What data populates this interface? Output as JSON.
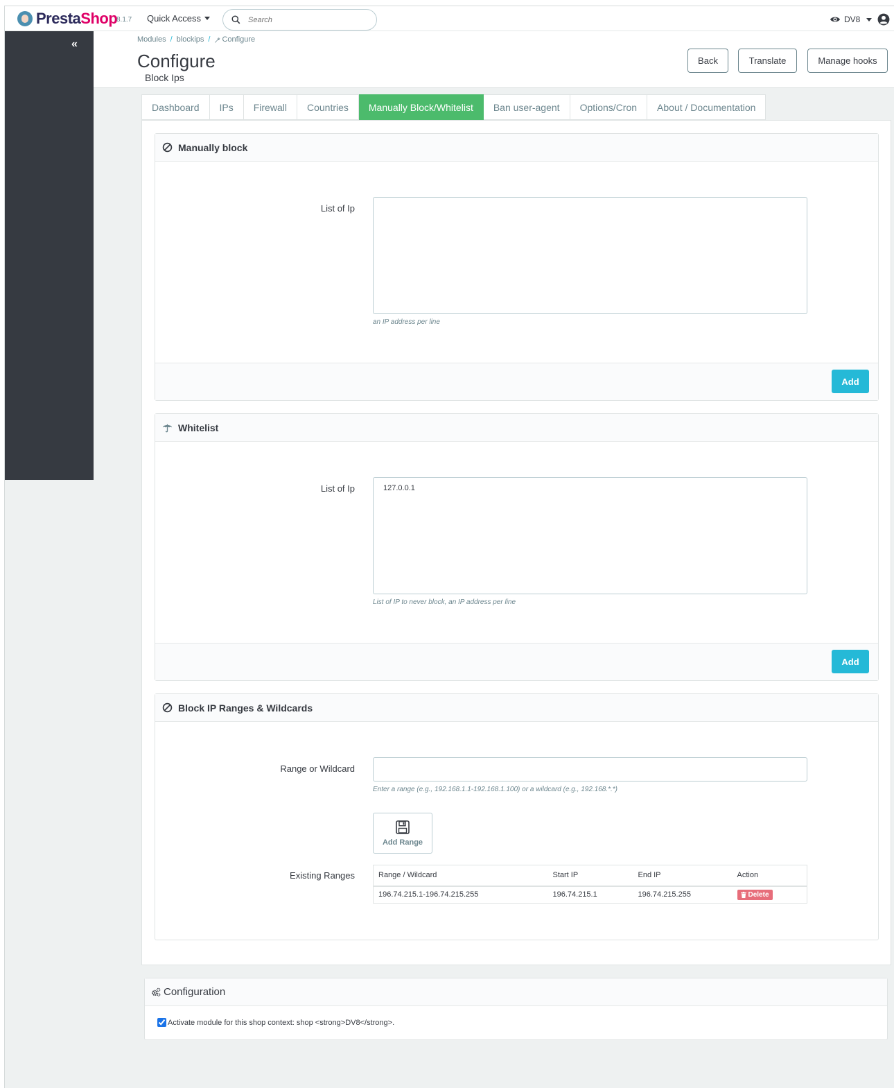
{
  "app": {
    "brand_part1": "Presta",
    "brand_part2": "Shop",
    "version": "8.1.7",
    "quick_access": "Quick Access",
    "search_placeholder": "Search",
    "shop_name": "DV8"
  },
  "breadcrumb": [
    "Modules",
    "blockips",
    "Configure"
  ],
  "breadcrumb_sep": "/",
  "header": {
    "title": "Configure",
    "subtitle": "Block Ips",
    "buttons": {
      "back": "Back",
      "translate": "Translate",
      "manage_hooks": "Manage hooks"
    }
  },
  "tabs": [
    {
      "label": "Dashboard",
      "active": false
    },
    {
      "label": "IPs",
      "active": false
    },
    {
      "label": "Firewall",
      "active": false
    },
    {
      "label": "Countries",
      "active": false
    },
    {
      "label": "Manually Block/Whitelist",
      "active": true
    },
    {
      "label": "Ban user-agent",
      "active": false
    },
    {
      "label": "Options/Cron",
      "active": false
    },
    {
      "label": "About / Documentation",
      "active": false
    }
  ],
  "manual_block": {
    "title": "Manually block",
    "label": "List of Ip",
    "value": "",
    "help": "an IP address per line",
    "button": "Add"
  },
  "whitelist": {
    "title": "Whitelist",
    "label": "List of Ip",
    "value": "127.0.0.1",
    "help": "List of IP to never block, an IP address per line",
    "button": "Add"
  },
  "ranges": {
    "title": "Block IP Ranges & Wildcards",
    "input_label": "Range or Wildcard",
    "input_value": "",
    "help": "Enter a range (e.g., 192.168.1.1-192.168.1.100) or a wildcard (e.g., 192.168.*.*)",
    "add_button": "Add Range",
    "existing_label": "Existing Ranges",
    "columns": [
      "Range / Wildcard",
      "Start IP",
      "End IP",
      "Action"
    ],
    "rows": [
      {
        "range": "196.74.215.1-196.74.215.255",
        "start": "196.74.215.1",
        "end": "196.74.215.255",
        "action": "Delete"
      }
    ]
  },
  "configuration": {
    "title": "Configuration",
    "activate_label": "Activate module for this shop context: shop <strong>DV8</strong>.",
    "activate_checked": true
  },
  "colors": {
    "sidebar": "#363a41",
    "tab_active": "#4cbb6c",
    "primary_button": "#25b9d7",
    "delete_button": "#e76d7a",
    "brand_pink": "#df0067"
  },
  "icons": {
    "manual_block": "ban-icon",
    "whitelist": "umbrella-icon",
    "ranges": "ban-icon",
    "add_range": "save-icon",
    "delete": "trash-icon",
    "configuration": "cogs-icon",
    "search": "search-icon",
    "shop_view": "eye-icon",
    "account": "user-circle-icon",
    "sidebar_collapse": "double-chevron-left-icon",
    "breadcrumb_configure": "wrench-icon"
  }
}
